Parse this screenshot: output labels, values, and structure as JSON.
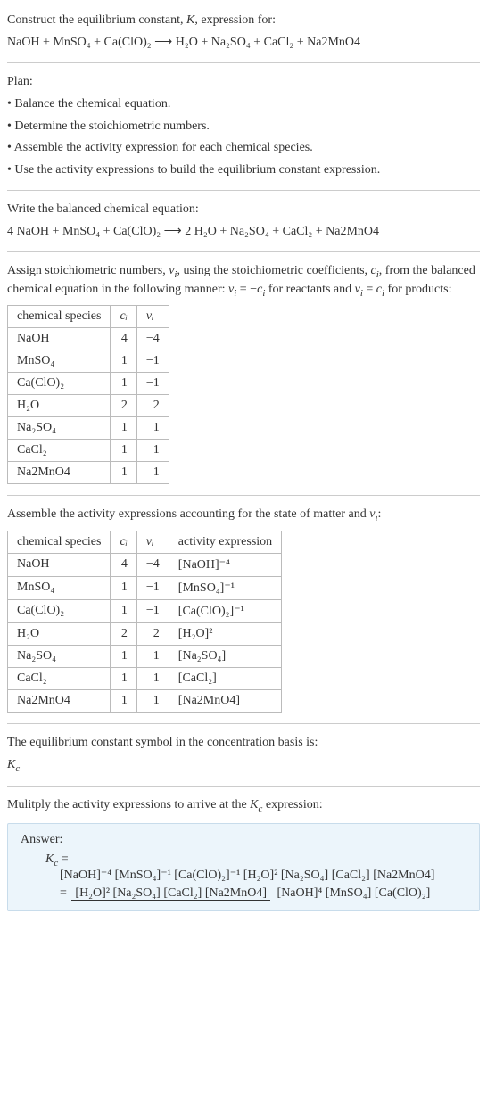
{
  "intro": {
    "line1_a": "Construct the equilibrium constant, ",
    "line1_b": "K",
    "line1_c": ", expression for:",
    "equation": "NaOH + MnSO₄ + Ca(ClO)₂ ⟶ H₂O + Na₂SO₄ + CaCl₂ + Na2MnO4"
  },
  "plan": {
    "heading": "Plan:",
    "b1": "• Balance the chemical equation.",
    "b2": "• Determine the stoichiometric numbers.",
    "b3": "• Assemble the activity expression for each chemical species.",
    "b4": "• Use the activity expressions to build the equilibrium constant expression."
  },
  "balanced": {
    "heading": "Write the balanced chemical equation:",
    "equation": "4 NaOH + MnSO₄ + Ca(ClO)₂ ⟶ 2 H₂O + Na₂SO₄ + CaCl₂ + Na2MnO4"
  },
  "stoich": {
    "intro_a": "Assign stoichiometric numbers, ",
    "nu": "ν",
    "sub_i": "i",
    "intro_b": ", using the stoichiometric coefficients, ",
    "c": "c",
    "intro_c": ", from the balanced chemical equation in the following manner: ",
    "rel1_a": "ν",
    "rel1_b": " = −",
    "rel1_c": "c",
    "intro_d": " for reactants and ",
    "rel2_a": "ν",
    "rel2_b": " = ",
    "rel2_c": "c",
    "intro_e": " for products:",
    "h1": "chemical species",
    "h2": "cᵢ",
    "h3": "νᵢ",
    "rows": [
      {
        "sp": "NaOH",
        "c": "4",
        "v": "−4"
      },
      {
        "sp": "MnSO₄",
        "c": "1",
        "v": "−1"
      },
      {
        "sp": "Ca(ClO)₂",
        "c": "1",
        "v": "−1"
      },
      {
        "sp": "H₂O",
        "c": "2",
        "v": "2"
      },
      {
        "sp": "Na₂SO₄",
        "c": "1",
        "v": "1"
      },
      {
        "sp": "CaCl₂",
        "c": "1",
        "v": "1"
      },
      {
        "sp": "Na2MnO4",
        "c": "1",
        "v": "1"
      }
    ]
  },
  "activity": {
    "heading_a": "Assemble the activity expressions accounting for the state of matter and ",
    "heading_b": "ν",
    "heading_c": ":",
    "h1": "chemical species",
    "h2": "cᵢ",
    "h3": "νᵢ",
    "h4": "activity expression",
    "rows": [
      {
        "sp": "NaOH",
        "c": "4",
        "v": "−4",
        "a": "[NaOH]⁻⁴"
      },
      {
        "sp": "MnSO₄",
        "c": "1",
        "v": "−1",
        "a": "[MnSO₄]⁻¹"
      },
      {
        "sp": "Ca(ClO)₂",
        "c": "1",
        "v": "−1",
        "a": "[Ca(ClO)₂]⁻¹"
      },
      {
        "sp": "H₂O",
        "c": "2",
        "v": "2",
        "a": "[H₂O]²"
      },
      {
        "sp": "Na₂SO₄",
        "c": "1",
        "v": "1",
        "a": "[Na₂SO₄]"
      },
      {
        "sp": "CaCl₂",
        "c": "1",
        "v": "1",
        "a": "[CaCl₂]"
      },
      {
        "sp": "Na2MnO4",
        "c": "1",
        "v": "1",
        "a": "[Na2MnO4]"
      }
    ]
  },
  "symbol": {
    "line": "The equilibrium constant symbol in the concentration basis is:",
    "kc_a": "K",
    "kc_b": "c"
  },
  "multiply": {
    "line_a": "Mulitply the activity expressions to arrive at the ",
    "kc_a": "K",
    "kc_b": "c",
    "line_b": " expression:"
  },
  "answer": {
    "label": "Answer:",
    "kc_eq_a": "K",
    "kc_eq_b": "c",
    "kc_eq_c": " =",
    "expr1": "[NaOH]⁻⁴ [MnSO₄]⁻¹ [Ca(ClO)₂]⁻¹ [H₂O]² [Na₂SO₄] [CaCl₂] [Na2MnO4]",
    "eq2": "= ",
    "num": "[H₂O]² [Na₂SO₄] [CaCl₂] [Na2MnO4]",
    "den": "[NaOH]⁴ [MnSO₄] [Ca(ClO)₂]"
  }
}
